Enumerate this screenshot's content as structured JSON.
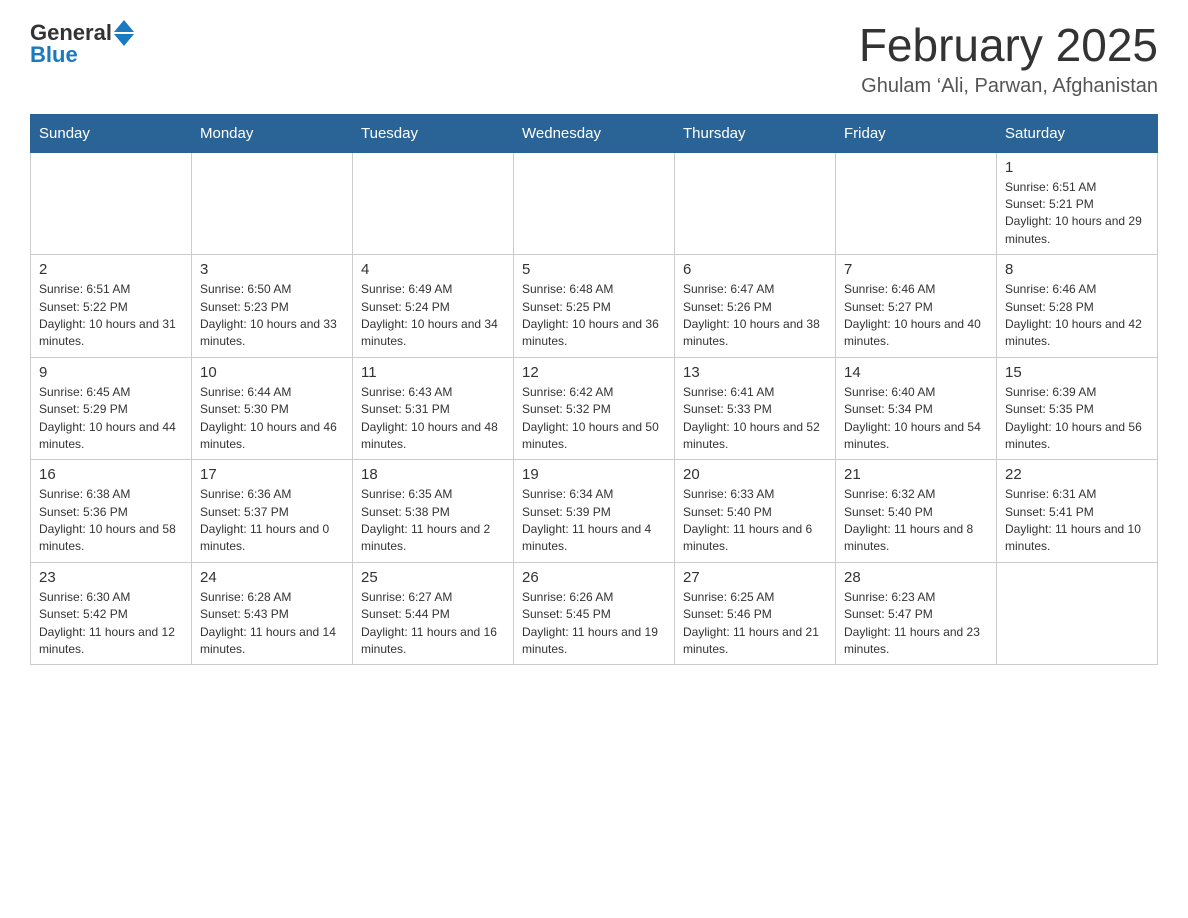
{
  "header": {
    "logo_general": "General",
    "logo_blue": "Blue",
    "month_title": "February 2025",
    "location": "Ghulam ‘Ali, Parwan, Afghanistan"
  },
  "days_of_week": [
    "Sunday",
    "Monday",
    "Tuesday",
    "Wednesday",
    "Thursday",
    "Friday",
    "Saturday"
  ],
  "weeks": [
    [
      {
        "day": "",
        "info": ""
      },
      {
        "day": "",
        "info": ""
      },
      {
        "day": "",
        "info": ""
      },
      {
        "day": "",
        "info": ""
      },
      {
        "day": "",
        "info": ""
      },
      {
        "day": "",
        "info": ""
      },
      {
        "day": "1",
        "info": "Sunrise: 6:51 AM\nSunset: 5:21 PM\nDaylight: 10 hours and 29 minutes."
      }
    ],
    [
      {
        "day": "2",
        "info": "Sunrise: 6:51 AM\nSunset: 5:22 PM\nDaylight: 10 hours and 31 minutes."
      },
      {
        "day": "3",
        "info": "Sunrise: 6:50 AM\nSunset: 5:23 PM\nDaylight: 10 hours and 33 minutes."
      },
      {
        "day": "4",
        "info": "Sunrise: 6:49 AM\nSunset: 5:24 PM\nDaylight: 10 hours and 34 minutes."
      },
      {
        "day": "5",
        "info": "Sunrise: 6:48 AM\nSunset: 5:25 PM\nDaylight: 10 hours and 36 minutes."
      },
      {
        "day": "6",
        "info": "Sunrise: 6:47 AM\nSunset: 5:26 PM\nDaylight: 10 hours and 38 minutes."
      },
      {
        "day": "7",
        "info": "Sunrise: 6:46 AM\nSunset: 5:27 PM\nDaylight: 10 hours and 40 minutes."
      },
      {
        "day": "8",
        "info": "Sunrise: 6:46 AM\nSunset: 5:28 PM\nDaylight: 10 hours and 42 minutes."
      }
    ],
    [
      {
        "day": "9",
        "info": "Sunrise: 6:45 AM\nSunset: 5:29 PM\nDaylight: 10 hours and 44 minutes."
      },
      {
        "day": "10",
        "info": "Sunrise: 6:44 AM\nSunset: 5:30 PM\nDaylight: 10 hours and 46 minutes."
      },
      {
        "day": "11",
        "info": "Sunrise: 6:43 AM\nSunset: 5:31 PM\nDaylight: 10 hours and 48 minutes."
      },
      {
        "day": "12",
        "info": "Sunrise: 6:42 AM\nSunset: 5:32 PM\nDaylight: 10 hours and 50 minutes."
      },
      {
        "day": "13",
        "info": "Sunrise: 6:41 AM\nSunset: 5:33 PM\nDaylight: 10 hours and 52 minutes."
      },
      {
        "day": "14",
        "info": "Sunrise: 6:40 AM\nSunset: 5:34 PM\nDaylight: 10 hours and 54 minutes."
      },
      {
        "day": "15",
        "info": "Sunrise: 6:39 AM\nSunset: 5:35 PM\nDaylight: 10 hours and 56 minutes."
      }
    ],
    [
      {
        "day": "16",
        "info": "Sunrise: 6:38 AM\nSunset: 5:36 PM\nDaylight: 10 hours and 58 minutes."
      },
      {
        "day": "17",
        "info": "Sunrise: 6:36 AM\nSunset: 5:37 PM\nDaylight: 11 hours and 0 minutes."
      },
      {
        "day": "18",
        "info": "Sunrise: 6:35 AM\nSunset: 5:38 PM\nDaylight: 11 hours and 2 minutes."
      },
      {
        "day": "19",
        "info": "Sunrise: 6:34 AM\nSunset: 5:39 PM\nDaylight: 11 hours and 4 minutes."
      },
      {
        "day": "20",
        "info": "Sunrise: 6:33 AM\nSunset: 5:40 PM\nDaylight: 11 hours and 6 minutes."
      },
      {
        "day": "21",
        "info": "Sunrise: 6:32 AM\nSunset: 5:40 PM\nDaylight: 11 hours and 8 minutes."
      },
      {
        "day": "22",
        "info": "Sunrise: 6:31 AM\nSunset: 5:41 PM\nDaylight: 11 hours and 10 minutes."
      }
    ],
    [
      {
        "day": "23",
        "info": "Sunrise: 6:30 AM\nSunset: 5:42 PM\nDaylight: 11 hours and 12 minutes."
      },
      {
        "day": "24",
        "info": "Sunrise: 6:28 AM\nSunset: 5:43 PM\nDaylight: 11 hours and 14 minutes."
      },
      {
        "day": "25",
        "info": "Sunrise: 6:27 AM\nSunset: 5:44 PM\nDaylight: 11 hours and 16 minutes."
      },
      {
        "day": "26",
        "info": "Sunrise: 6:26 AM\nSunset: 5:45 PM\nDaylight: 11 hours and 19 minutes."
      },
      {
        "day": "27",
        "info": "Sunrise: 6:25 AM\nSunset: 5:46 PM\nDaylight: 11 hours and 21 minutes."
      },
      {
        "day": "28",
        "info": "Sunrise: 6:23 AM\nSunset: 5:47 PM\nDaylight: 11 hours and 23 minutes."
      },
      {
        "day": "",
        "info": ""
      }
    ]
  ]
}
